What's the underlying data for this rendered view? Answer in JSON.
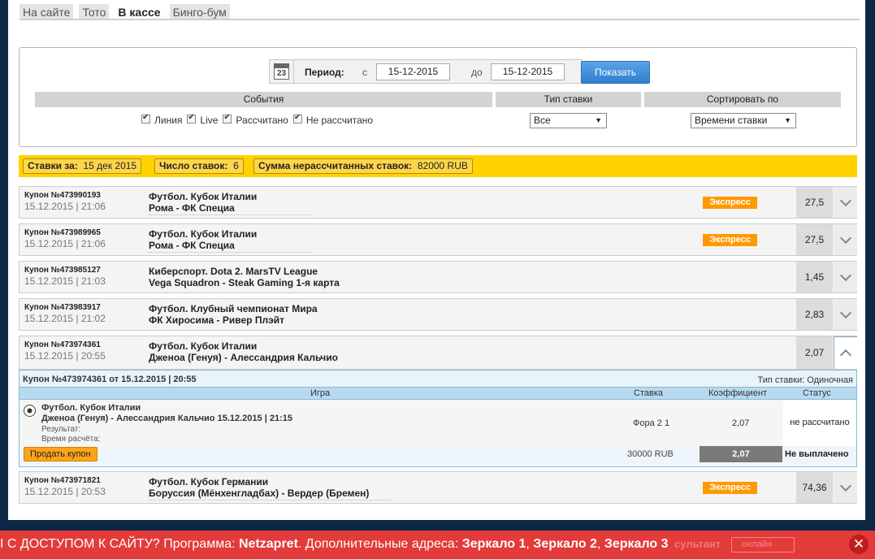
{
  "tabs": [
    "На сайте",
    "Тото",
    "В кассе",
    "Бинго-бум"
  ],
  "filter": {
    "calendar_day": "23",
    "period_label": "Период:",
    "from_label": "с",
    "from_date": "15-12-2015",
    "to_label": "до",
    "to_date": "15-12-2015",
    "show_button": "Показать",
    "events_header": "События",
    "bet_type_header": "Тип ставки",
    "sort_header": "Сортировать по",
    "checkboxes": [
      "Линия",
      "Live",
      "Рассчитано",
      "Не рассчитано"
    ],
    "bet_type_value": "Все",
    "sort_value": "Времени ставки"
  },
  "summary": {
    "bets_for_label": "Ставки за:",
    "bets_for_value": "15 дек 2015",
    "count_label": "Число ставок:",
    "count_value": "6",
    "sum_label": "Сумма нерассчитанных ставок:",
    "sum_value": "82000 RUB"
  },
  "coupons": [
    {
      "num": "Купон №473990193",
      "datetime": "15.12.2015 | 21:06",
      "line1": "Футбол. Кубок Италии",
      "line2": "Рома - ФК Специа",
      "badge": "Экспресс",
      "coef": "27,5"
    },
    {
      "num": "Купон №473989965",
      "datetime": "15.12.2015 | 21:06",
      "line1": "Футбол. Кубок Италии",
      "line2": "Рома - ФК Специа",
      "badge": "Экспресс",
      "coef": "27,5"
    },
    {
      "num": "Купон №473985127",
      "datetime": "15.12.2015 | 21:03",
      "line1": "Киберспорт. Dota 2. MarsTV League",
      "line2": "Vega Squadron - Steak Gaming 1-я карта",
      "badge": "",
      "coef": "1,45"
    },
    {
      "num": "Купон №473983917",
      "datetime": "15.12.2015 | 21:02",
      "line1": "Футбол. Клубный чемпионат Мира",
      "line2": "ФК Хиросима - Ривер Плэйт",
      "badge": "",
      "coef": "2,83"
    },
    {
      "num": "Купон №473974361",
      "datetime": "15.12.2015 | 20:55",
      "line1": "Футбол. Кубок Италии",
      "line2": "Дженоа (Генуя) - Алессандрия Кальчио",
      "badge": "",
      "coef": "2,07"
    },
    {
      "num": "Купон №473971821",
      "datetime": "15.12.2015 | 20:53",
      "line1": "Футбол. Кубок Германии",
      "line2": "Боруссия (Мёнхенгладбах) - Вердер (Бремен)",
      "badge": "Экспресс",
      "coef": "74,36"
    }
  ],
  "details": {
    "header": "Купон №473974361 от 15.12.2015 | 20:55",
    "bet_type": "Тип ставки: Одиночная",
    "col_game": "Игра",
    "col_bet": "Ставка",
    "col_coef": "Коэффициент",
    "col_status": "Статус",
    "event_line1": "Футбол. Кубок Италии",
    "event_line2": "Дженоа (Генуя) - Алессандрия Кальчио 15.12.2015 | 21:15",
    "result_label": "Результат:",
    "calc_time_label": "Время расчёта:",
    "bet": "Фора 2 1",
    "coef": "2,07",
    "status": "не рассчитано",
    "sell_button": "Продать купон",
    "amount": "30000 RUB",
    "total_coef": "2,07",
    "payout_status": "Не выплачено"
  },
  "banner": {
    "prefix": "I С ДОСТУПОМ К САЙТУ?",
    "program_label": " Программа: ",
    "program": "Netzapret",
    "extra_label": ". Дополнительные адреса: ",
    "mirror1": "Зеркало 1",
    "mirror2": "Зеркало 2",
    "mirror3": "Зеркало 3",
    "ghost_text": "сультант",
    "ghost_box": "онлайн",
    "close": "✕"
  }
}
